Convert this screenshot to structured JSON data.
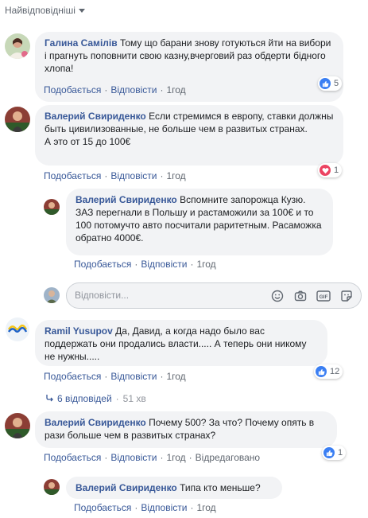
{
  "sort": {
    "label": "Найвідповідніші"
  },
  "comments": [
    {
      "author": "Галина Самілів",
      "text": "Тому що барани знову готуються йти на вибори і прагнуть поповнити свою казну,вчерговий раз обдерти бідного хлопа!",
      "like_label": "Подобається",
      "reply_label": "Відповісти",
      "time": "1год",
      "reaction_count": "5",
      "reaction_type": "like"
    },
    {
      "author": "Валерий Свириденко",
      "text": "Если стремимся в европу, ставки должны быть цивилизованные, не больше чем в развитых странах.",
      "text2": "А это от 15 до 100€",
      "like_label": "Подобається",
      "reply_label": "Відповісти",
      "time": "1год",
      "reaction_count": "1",
      "reaction_type": "love",
      "reply": {
        "author": "Валерий Свириденко",
        "text": "Вспомните запорожца Кузю. ЗАЗ перегнали в Польшу и растаможили за 100€ и то 100 потомучто авто посчитали раритетным. Расаможка обратно 4000€.",
        "like_label": "Подобається",
        "reply_label": "Відповісти",
        "time": "1год"
      }
    },
    {
      "author": "Ramil Yusupov",
      "text": "Да, Давид, а когда надо было вас поддержать они продались власти..... А теперь они никому не нужны.....",
      "like_label": "Подобається",
      "reply_label": "Відповісти",
      "time": "1год",
      "reaction_count": "12",
      "reaction_type": "like",
      "replies_count_label": "6 відповідей",
      "replies_time": "51 хв"
    },
    {
      "author": "Валерий Свириденко",
      "text": "Почему 500? За что? Почему опять в рази больше чем в развитых странах?",
      "like_label": "Подобається",
      "reply_label": "Відповісти",
      "time": "1год",
      "edited_label": "Відредаговано",
      "reaction_count": "1",
      "reaction_type": "like",
      "reply": {
        "author": "Валерий Свириденко",
        "text": "Типа кто меньше?",
        "like_label": "Подобається",
        "reply_label": "Відповісти",
        "time": "1год"
      }
    }
  ],
  "reply_box": {
    "placeholder": "Відповісти...",
    "icons": [
      "emoji-icon",
      "camera-icon",
      "gif-icon",
      "sticker-icon"
    ]
  },
  "colors": {
    "link": "#385898",
    "bubble": "#f2f3f5",
    "like": "#3b7ff3",
    "love": "#ec4462"
  }
}
